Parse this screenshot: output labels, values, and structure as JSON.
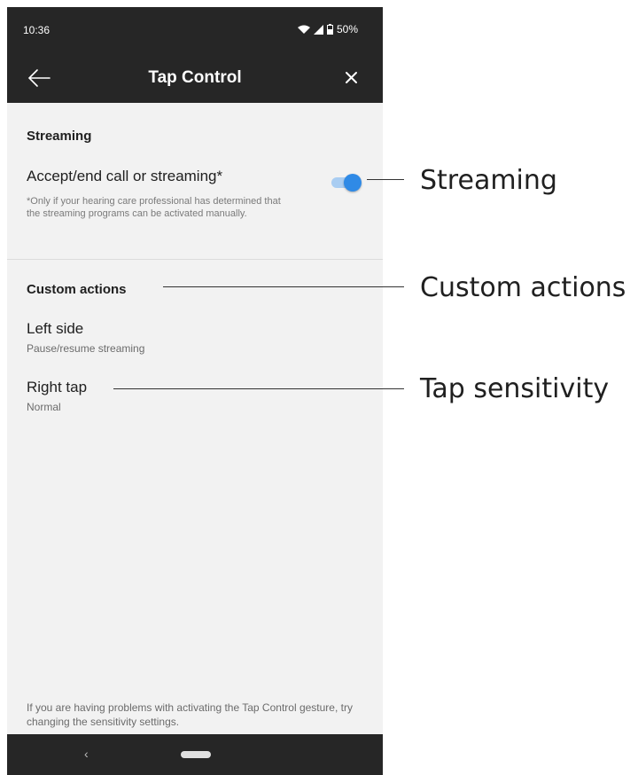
{
  "status_bar": {
    "time": "10:36",
    "battery": "50%",
    "wifi_icon": "wifi-icon",
    "signal_icon": "signal-icon",
    "battery_icon": "battery-icon"
  },
  "app_bar": {
    "title": "Tap Control",
    "back_icon": "arrow-left-icon",
    "close_icon": "close-icon"
  },
  "streaming_section": {
    "header": "Streaming",
    "toggle_label": "Accept/end call or streaming*",
    "toggle_on": true,
    "footnote": "*Only if your hearing care professional has determined that the streaming programs can be activated manually."
  },
  "custom_actions_section": {
    "header": "Custom actions",
    "items": [
      {
        "title": "Left side",
        "subtitle": "Pause/resume streaming"
      },
      {
        "title": "Right tap",
        "subtitle": "Normal"
      }
    ]
  },
  "bottom_note": "If you are having problems with activating the Tap Control gesture, try changing the sensitivity settings.",
  "nav_bar": {
    "back_glyph": "‹"
  },
  "annotations": [
    "Streaming",
    "Custom actions",
    "Tap sensitivity"
  ],
  "colors": {
    "toggle_thumb": "#2f8ae6",
    "toggle_track": "#a9cdf2",
    "app_bar": "#262626",
    "background": "#f2f2f2"
  }
}
